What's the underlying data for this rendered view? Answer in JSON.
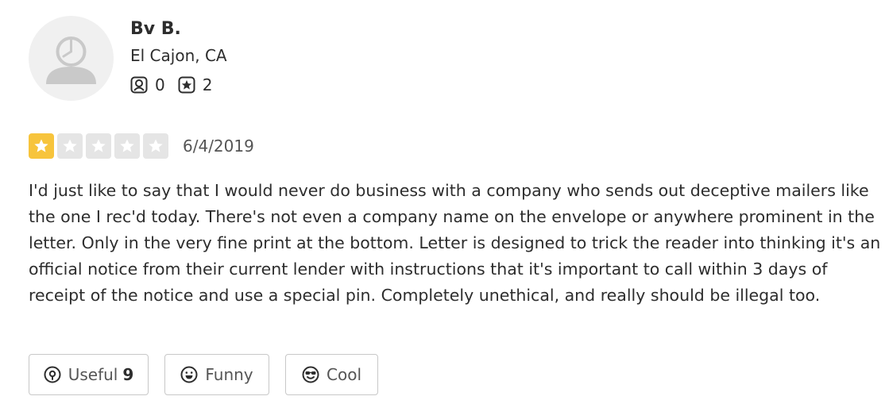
{
  "reviewer": {
    "name": "Bv B.",
    "location": "El Cajon, CA",
    "avatar_icon": "default-user-avatar",
    "stats": {
      "friends_icon": "friends-icon",
      "friends": "0",
      "reviews_icon": "reviews-icon",
      "reviews": "2"
    }
  },
  "review": {
    "rating": 1,
    "max_rating": 5,
    "star_color": "#f7c43c",
    "date": "6/4/2019",
    "text": "I'd just like to say that I would never do business with a company who sends out deceptive mailers like the one I rec'd today. There's not even a company name on the envelope or anywhere prominent in the letter. Only in the very fine print at the bottom. Letter is designed to trick the reader into thinking it's an official notice from their current lender with instructions that it's important to call within 3 days of receipt of the notice and use a special pin. Completely unethical, and really should be illegal too."
  },
  "actions": {
    "useful_label": "Useful",
    "useful_count": "9",
    "funny_label": "Funny",
    "cool_label": "Cool"
  }
}
